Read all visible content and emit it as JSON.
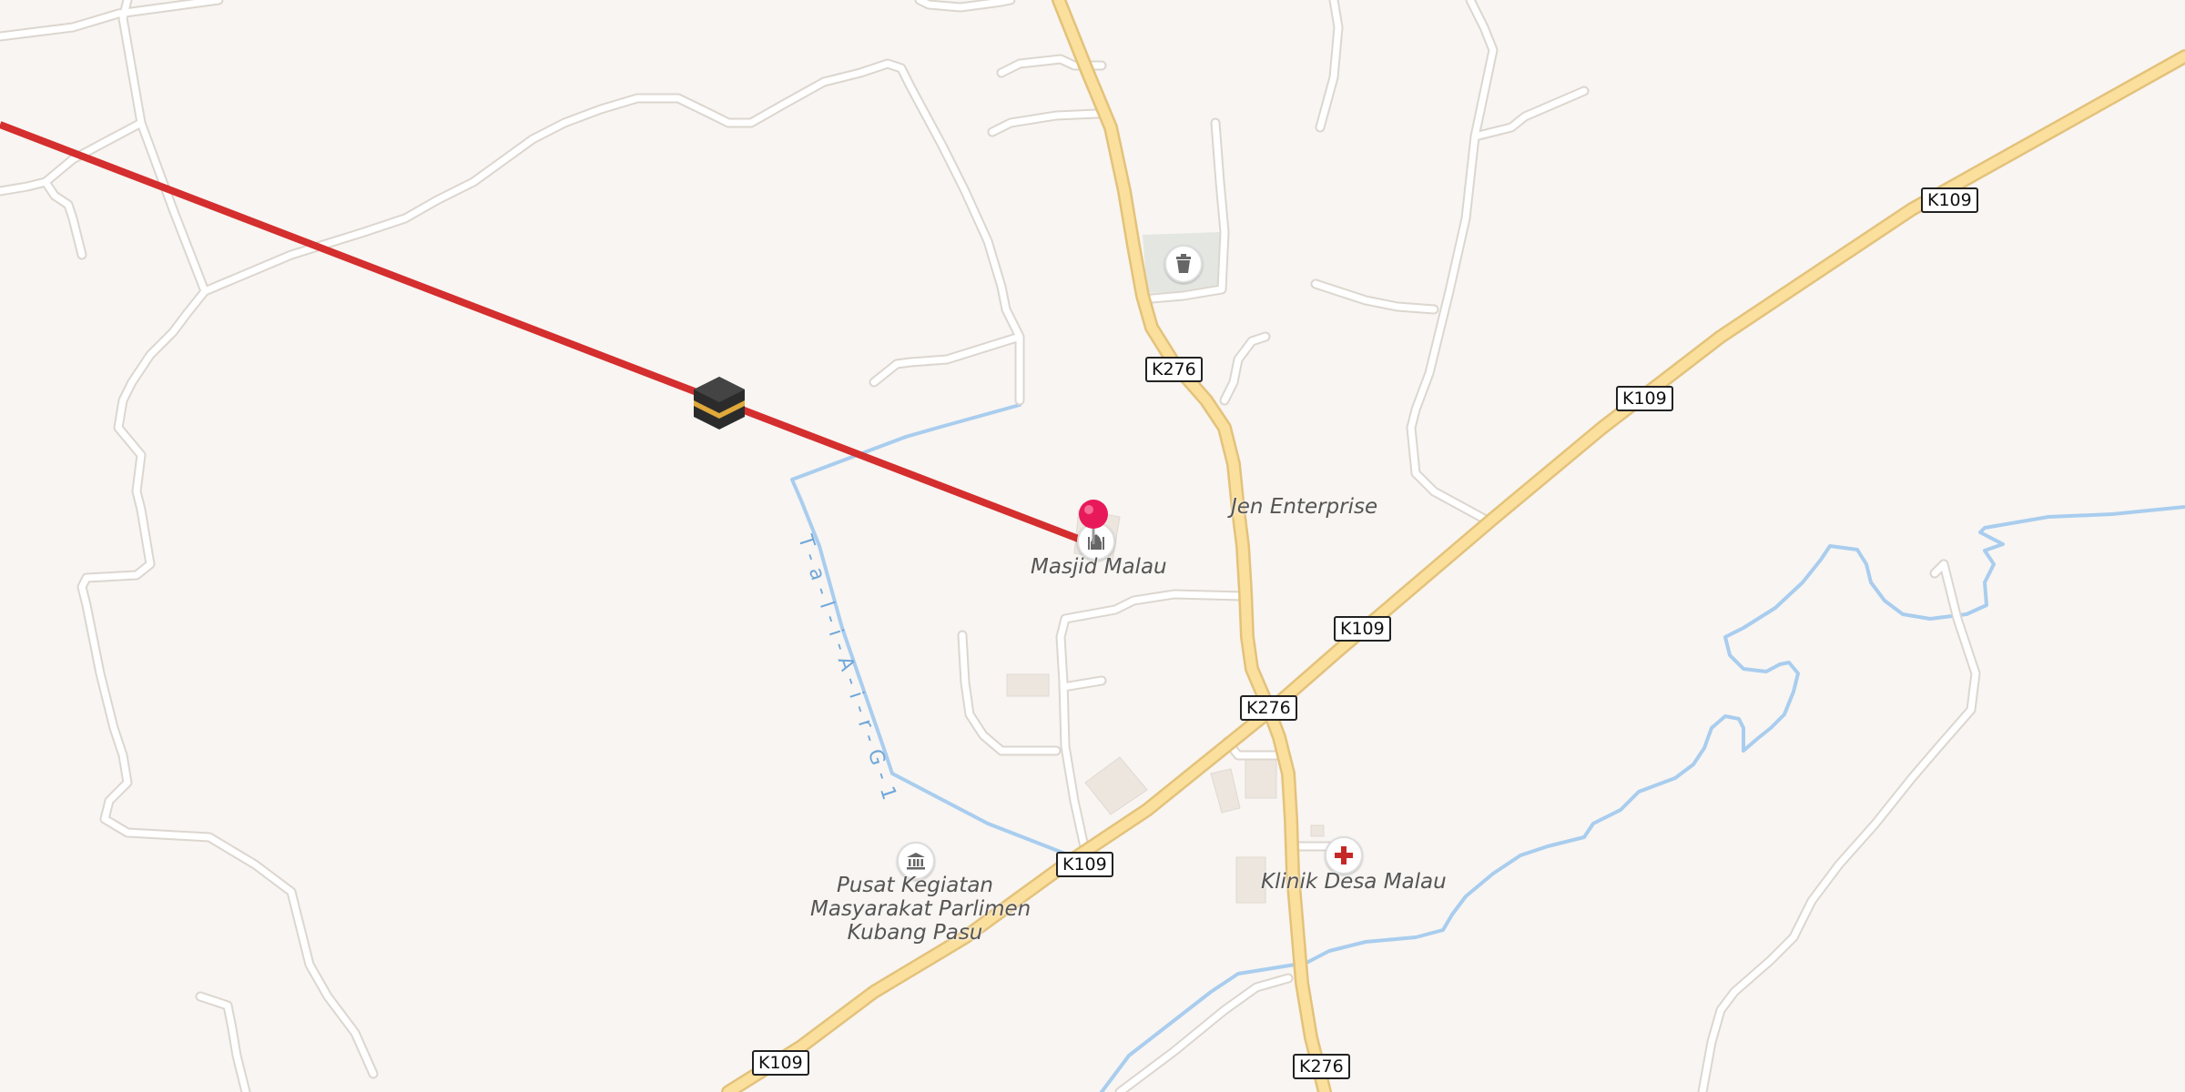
{
  "map": {
    "road_shields": [
      {
        "id": "k276-north",
        "text": "K276"
      },
      {
        "id": "k276-junction",
        "text": "K276"
      },
      {
        "id": "k276-south",
        "text": "K276"
      },
      {
        "id": "k109-northeast",
        "text": "K109"
      },
      {
        "id": "k109-east",
        "text": "K109"
      },
      {
        "id": "k109-center",
        "text": "K109"
      },
      {
        "id": "k109-mid",
        "text": "K109"
      },
      {
        "id": "k109-south",
        "text": "K109"
      }
    ],
    "places": {
      "mosque": "Masjid Malau",
      "enterprise": "Jen Enterprise",
      "clinic": "Klinik Desa Malau",
      "community_center_line1": "Pusat Kegiatan",
      "community_center_line2": "Masyarakat Parlimen",
      "community_center_line3": "Kubang Pasu"
    },
    "waterway_label": "T-a-l-i-A-i-r-G-1",
    "colors": {
      "background": "#f8f5f2",
      "major_road": "#fbdf9c",
      "minor_road": "#ffffff",
      "river": "#a9cdee",
      "qibla_line": "#d42e2e",
      "pin": "#e8195a"
    },
    "icons": [
      "kaaba-icon",
      "location-pin-icon",
      "mosque-icon",
      "trash-bin-icon",
      "museum-icon",
      "medical-cross-icon"
    ]
  }
}
